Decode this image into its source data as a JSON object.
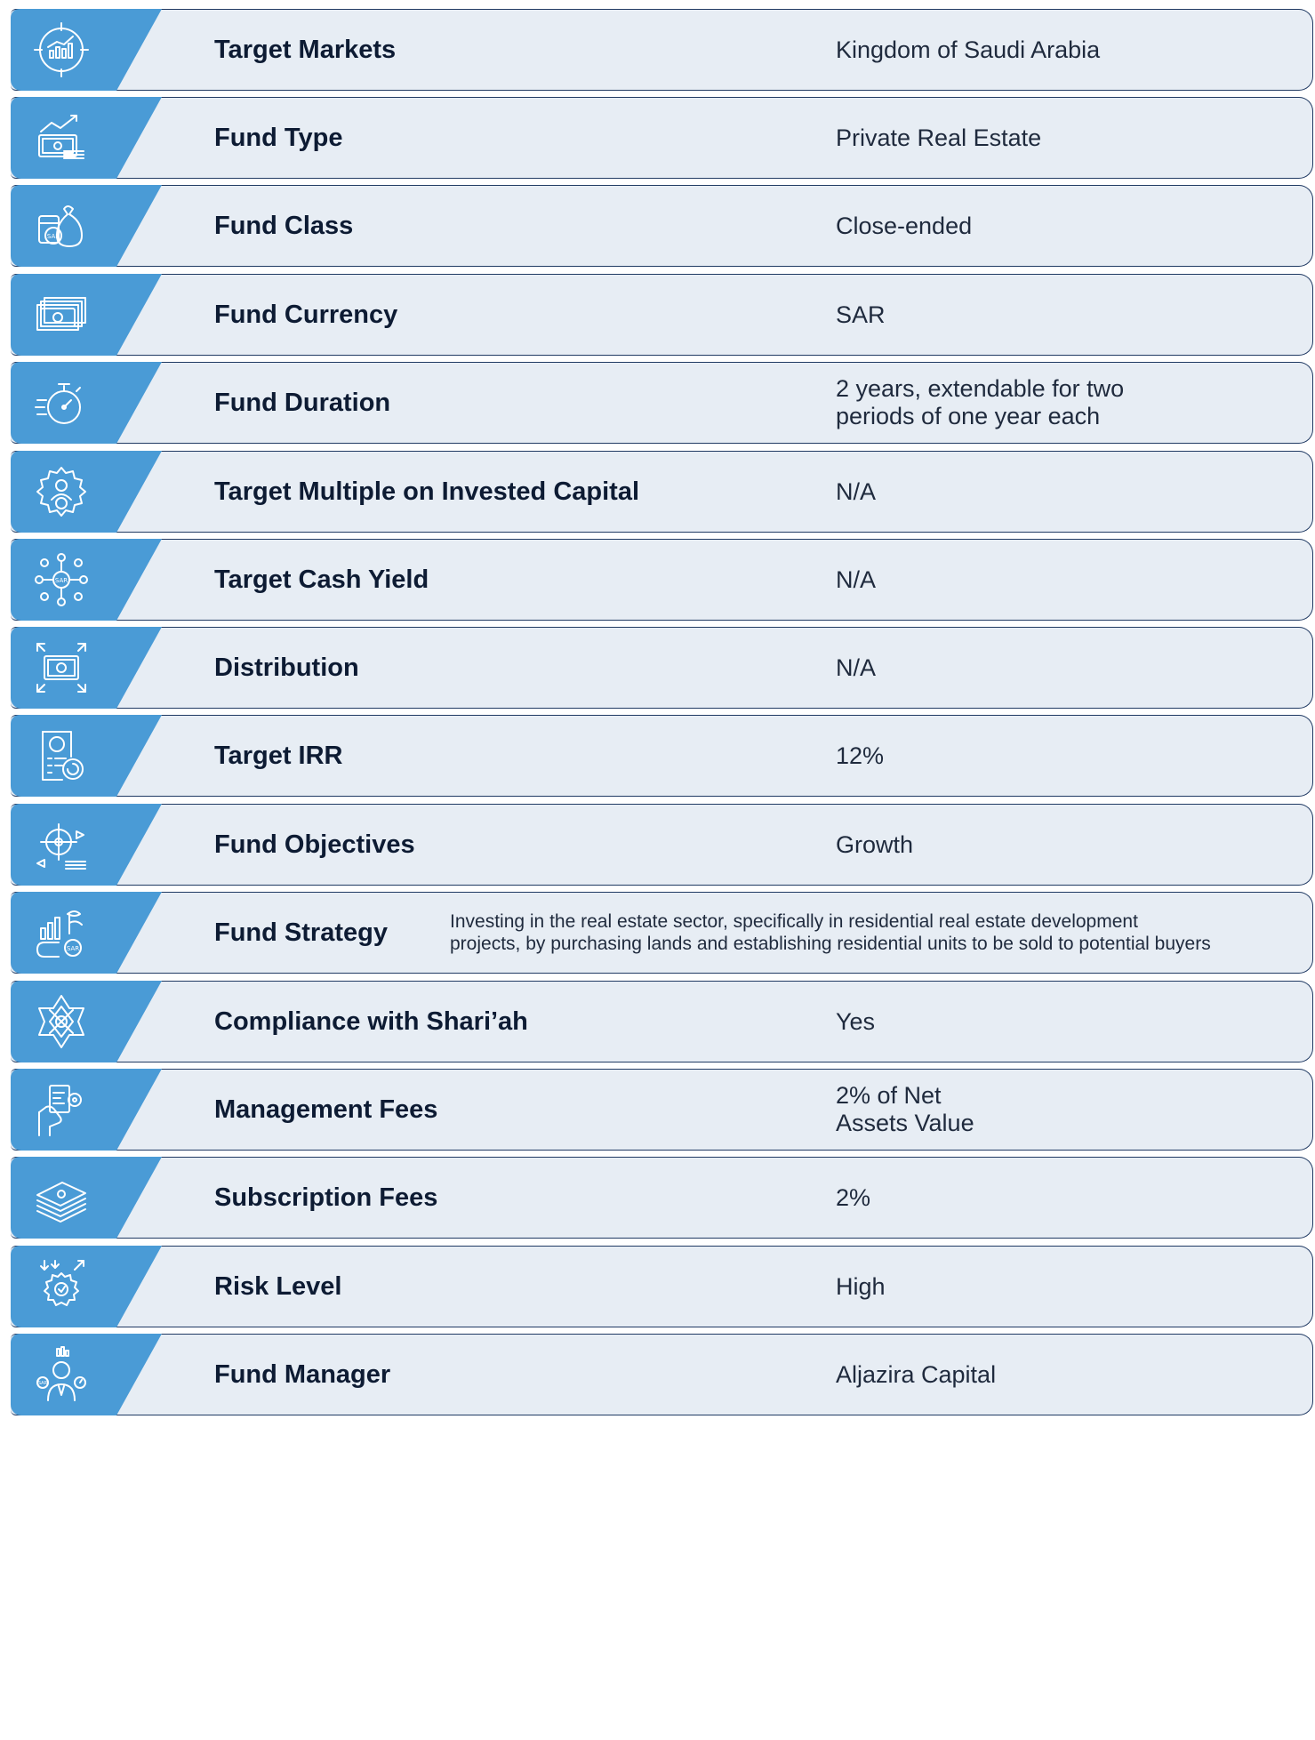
{
  "colors": {
    "tab": "#4a9bd6",
    "band": "#e7edf4",
    "border": "#203a63",
    "label": "#0d1b33"
  },
  "rows": [
    {
      "label": "Target Markets",
      "value": "Kingdom of Saudi Arabia",
      "icon": "target-market-chart-icon"
    },
    {
      "label": "Fund Type",
      "value": "Private Real Estate",
      "icon": "money-growth-icon"
    },
    {
      "label": "Fund Class",
      "value": "Close-ended",
      "icon": "money-bag-sar-icon"
    },
    {
      "label": "Fund Currency",
      "value": "SAR",
      "icon": "banknotes-icon"
    },
    {
      "label": "Fund Duration",
      "value": "2 years, extendable for two\nperiods of one year each",
      "icon": "stopwatch-icon"
    },
    {
      "label": "Target Multiple on Invested Capital",
      "value": "N/A",
      "icon": "gear-person-sar-icon"
    },
    {
      "label": "Target Cash Yield",
      "value": "N/A",
      "icon": "network-sar-icon"
    },
    {
      "label": "Distribution",
      "value": "N/A",
      "icon": "banknote-arrows-icon"
    },
    {
      "label": "Target IRR",
      "value": "12%",
      "icon": "document-dollar-icon"
    },
    {
      "label": "Fund Objectives",
      "value": "Growth",
      "icon": "target-objectives-icon"
    },
    {
      "label": "Fund Strategy",
      "value": "Investing in the real estate sector, specifically in residential real estate development\nprojects, by purchasing lands and establishing residential units to be sold to potential buyers",
      "icon": "strategy-growth-icon"
    },
    {
      "label": "Compliance with Shari’ah",
      "value": "Yes",
      "icon": "islamic-pattern-icon"
    },
    {
      "label": "Management Fees",
      "value": "2% of Net\nAssets Value",
      "icon": "hand-settings-icon"
    },
    {
      "label": "Subscription Fees",
      "value": "2%",
      "icon": "money-stack-icon"
    },
    {
      "label": "Risk Level",
      "value": "High",
      "icon": "risk-gear-icon"
    },
    {
      "label": "Fund Manager",
      "value": "Aljazira Capital",
      "icon": "manager-person-icon"
    }
  ]
}
